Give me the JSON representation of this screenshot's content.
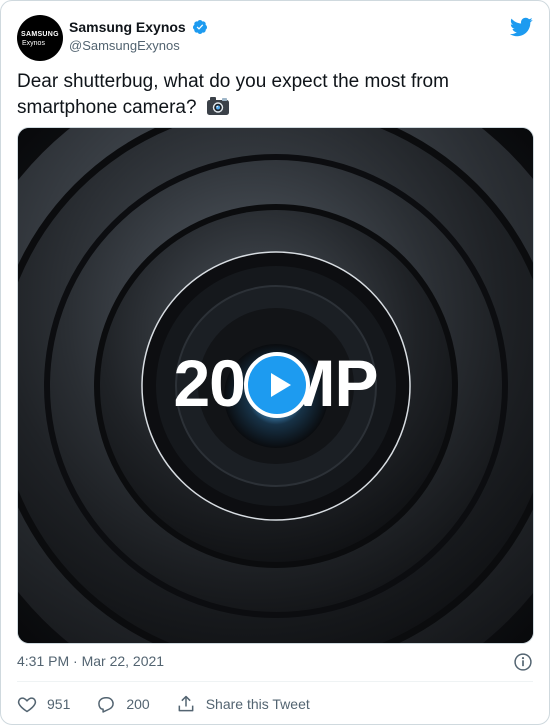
{
  "author": {
    "display_name": "Samsung Exynos",
    "handle": "@SamsungExynos",
    "avatar_line1": "SAMSUNG",
    "avatar_line2": "Exynos"
  },
  "tweet": {
    "text": "Dear shutterbug, what do you expect the most from smartphone camera?",
    "emoji": "camera-with-flash",
    "timestamp": "4:31 PM · Mar 22, 2021"
  },
  "media": {
    "overlay_text": "200MP",
    "type": "video",
    "play_icon": "play-icon"
  },
  "actions": {
    "likes": "951",
    "replies": "200",
    "share_label": "Share this Tweet"
  },
  "colors": {
    "accent": "#1d9bf0",
    "text": "#0f1419",
    "secondary": "#536471",
    "border": "#cfd9de"
  }
}
